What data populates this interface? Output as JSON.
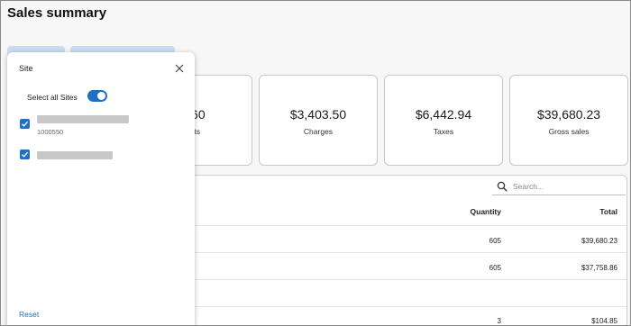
{
  "header": {
    "title": "Sales summary"
  },
  "summary_cards": [
    {
      "value": "2.60",
      "label": "unts"
    },
    {
      "value": "$3,403.50",
      "label": "Charges"
    },
    {
      "value": "$6,442.94",
      "label": "Taxes"
    },
    {
      "value": "$39,680.23",
      "label": "Gross sales"
    }
  ],
  "search": {
    "placeholder": "Search..."
  },
  "table": {
    "columns": [
      "Quantity",
      "Total"
    ],
    "rows": [
      {
        "quantity": "605",
        "total": "$39,680.23"
      },
      {
        "quantity": "605",
        "total": "$37,758.86"
      },
      {
        "quantity": "3",
        "total": "$104.85"
      }
    ]
  },
  "site_panel": {
    "title": "Site",
    "select_all_label": "Select all Sites",
    "select_all_on": true,
    "sites": [
      {
        "id": "1000550",
        "checked": true
      },
      {
        "id": "",
        "checked": true
      }
    ],
    "reset_label": "Reset"
  },
  "colors": {
    "accent": "#1f6fc5",
    "chip": "#c9ddf2"
  },
  "icons": [
    "close-icon",
    "search-icon",
    "checkmark-icon"
  ]
}
